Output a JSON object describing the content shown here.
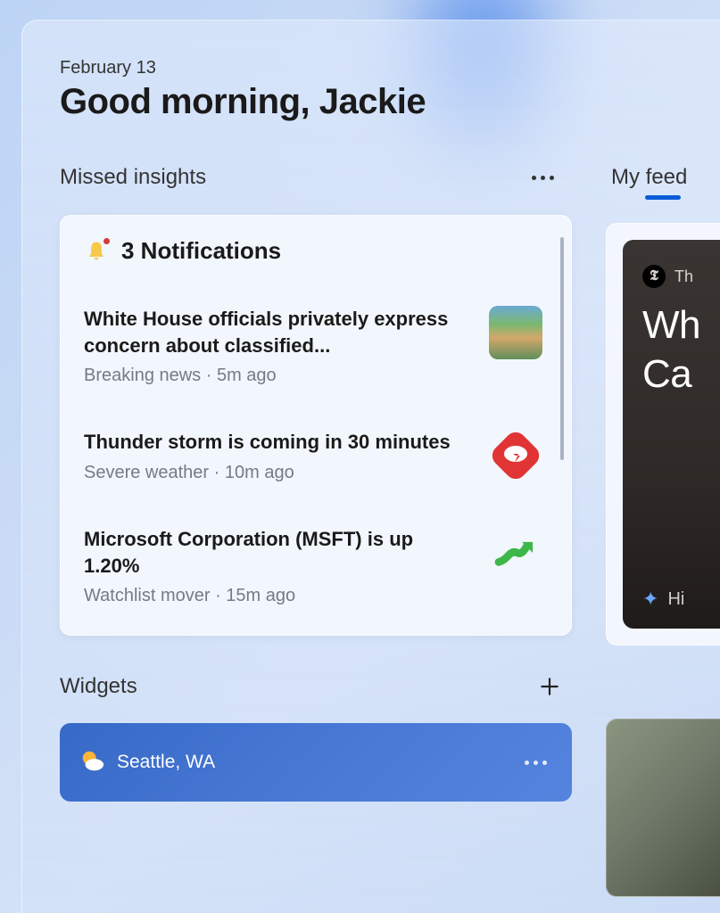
{
  "header": {
    "date": "February 13",
    "greeting": "Good morning, Jackie"
  },
  "insights": {
    "title": "Missed insights",
    "notifications_title": "3 Notifications",
    "items": [
      {
        "headline": "White House officials privately express concern about classified...",
        "category": "Breaking news",
        "time": "5m ago"
      },
      {
        "headline": "Thunder storm is coming in 30 minutes",
        "category": "Severe weather",
        "time": "10m ago"
      },
      {
        "headline": "Microsoft Corporation (MSFT) is up 1.20%",
        "category": "Watchlist mover",
        "time": "15m ago"
      }
    ]
  },
  "widgets": {
    "title": "Widgets",
    "weather": {
      "location": "Seattle, WA"
    }
  },
  "feed": {
    "title": "My feed",
    "card": {
      "source": "Th",
      "headline_line1": "Wh",
      "headline_line2": "Ca",
      "footer": "Hi"
    }
  }
}
